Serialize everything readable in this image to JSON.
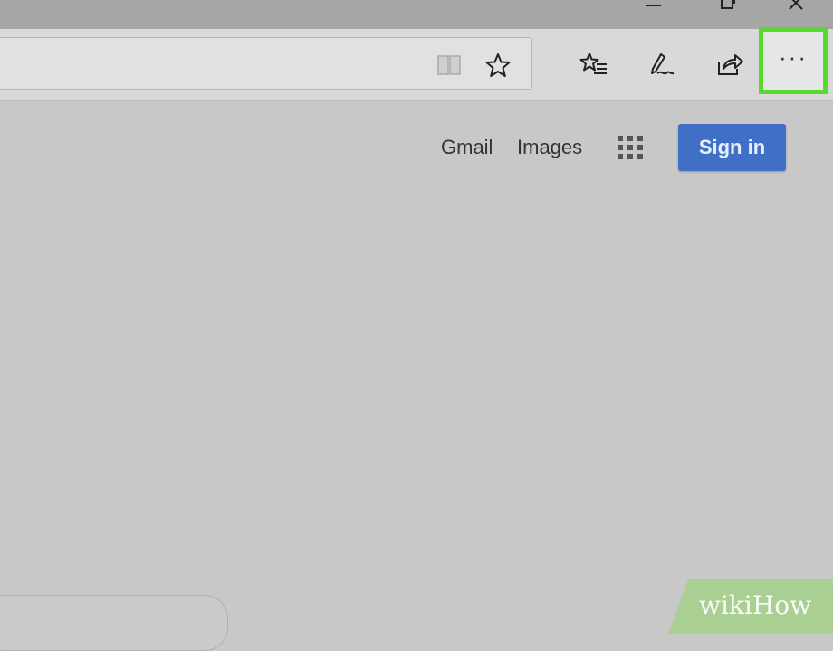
{
  "window_controls": {
    "minimize_icon": "minimize-icon",
    "restore_icon": "restore-icon",
    "close_icon": "close-icon"
  },
  "toolbar": {
    "icons": [
      "reading-view-icon",
      "favorite-star-icon",
      "favorites-hub-icon",
      "web-notes-pen-icon",
      "share-icon"
    ],
    "more_label": "···",
    "more_highlight_color": "#59d82f"
  },
  "page": {
    "gmail_label": "Gmail",
    "images_label": "Images",
    "apps_icon": "apps-grid-icon",
    "signin_label": "Sign in",
    "signin_color": "#3f6fc7"
  },
  "watermark": {
    "text": "wikiHow"
  }
}
